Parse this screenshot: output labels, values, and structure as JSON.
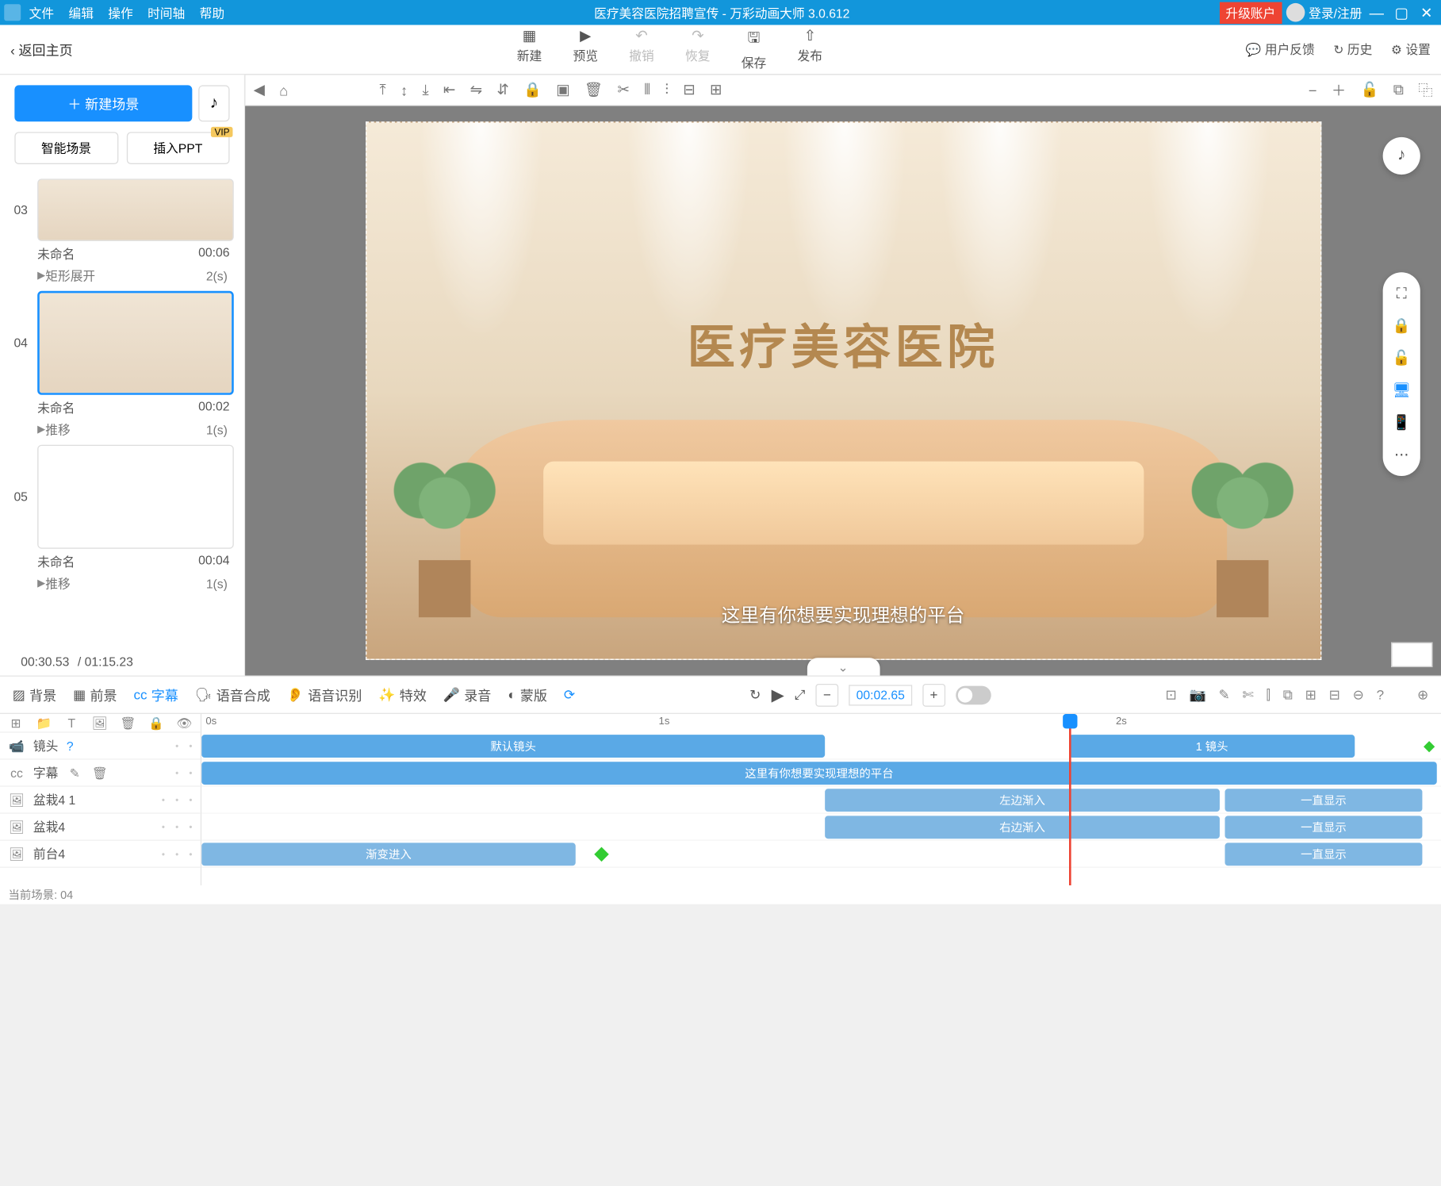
{
  "titlebar": {
    "menus": [
      "文件",
      "编辑",
      "操作",
      "时间轴",
      "帮助"
    ],
    "title": "医疗美容医院招聘宣传 - 万彩动画大师 3.0.612",
    "upgrade": "升级账户",
    "login": "登录/注册"
  },
  "apptool": {
    "back": "‹ 返回主页",
    "new": "新建",
    "preview": "预览",
    "undo": "撤销",
    "redo": "恢复",
    "save": "保存",
    "publish": "发布",
    "feedback": "用户反馈",
    "history": "历史",
    "settings": "设置"
  },
  "left": {
    "newscene": "＋ 新建场景",
    "smartscene": "智能场景",
    "insertppt": "插入PPT",
    "vip": "VIP",
    "scene03": {
      "num": "03",
      "name": "未命名",
      "dur": "00:06",
      "trans": "矩形展开",
      "transdur": "2(s)"
    },
    "scene04": {
      "num": "04",
      "name": "未命名",
      "dur": "00:02",
      "trans": "推移",
      "transdur": "1(s)"
    },
    "scene05": {
      "num": "05",
      "name": "未命名",
      "dur": "00:04",
      "trans": "推移",
      "transdur": "1(s)"
    },
    "time": {
      "cur": "00:30.53",
      "total": "/ 01:15.23"
    }
  },
  "canvas": {
    "sign": "医疗美容医院",
    "subtitle": "这里有你想要实现理想的平台"
  },
  "btool": {
    "bg": "背景",
    "fg": "前景",
    "sub": "字幕",
    "tts": "语音合成",
    "asr": "语音识别",
    "fx": "特效",
    "rec": "录音",
    "mask": "蒙版",
    "timecode": "00:02.65"
  },
  "ruler": {
    "t0": "0s",
    "t1": "1s",
    "t2": "2s"
  },
  "tracks": {
    "camera": "镜头",
    "camera_default": "默认镜头",
    "camera_1": "1 镜头",
    "subtitle": "字幕",
    "subtitle_text": "这里有你想要实现理想的平台",
    "pot1": "盆栽4 1",
    "pot1_in": "左边渐入",
    "pot1_stay": "一直显示",
    "pot2": "盆栽4",
    "pot2_in": "右边渐入",
    "pot2_stay": "一直显示",
    "desk": "前台4",
    "desk_in": "渐变进入",
    "desk_stay": "一直显示"
  },
  "status": "当前场景: 04"
}
